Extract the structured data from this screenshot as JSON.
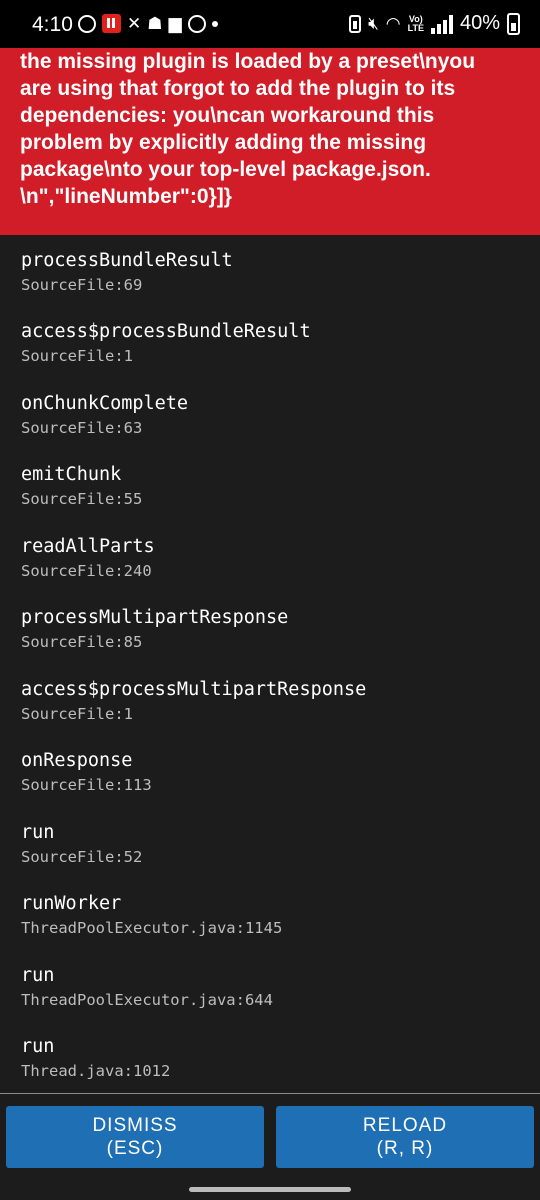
{
  "status_bar": {
    "time": "4:10",
    "battery": "40%",
    "left_icons": [
      "whatsapp-icon",
      "vi-app-icon",
      "missed-call-icon",
      "snapchat-icon",
      "teams-icon",
      "app-icon"
    ],
    "right_icons": [
      "battery-saver-icon",
      "mute-icon",
      "wifi-icon",
      "volte-icon",
      "signal-icon",
      "battery-icon"
    ],
    "volte_label": "Vo) R\nLTE"
  },
  "error": {
    "message": "y ... g y ... p\nthe missing plugin is loaded by a preset\\nyou\nare using that forgot to add the plugin to its\ndependencies: you\\ncan workaround this\nproblem by explicitly adding the missing\npackage\\nto your top-level package.json.\n\\n\",\"lineNumber\":0}]}",
    "background": "#d01d28"
  },
  "stack_frames": [
    {
      "method": "processBundleResult",
      "source": "SourceFile:69"
    },
    {
      "method": "access$processBundleResult",
      "source": "SourceFile:1"
    },
    {
      "method": "onChunkComplete",
      "source": "SourceFile:63"
    },
    {
      "method": "emitChunk",
      "source": "SourceFile:55"
    },
    {
      "method": "readAllParts",
      "source": "SourceFile:240"
    },
    {
      "method": "processMultipartResponse",
      "source": "SourceFile:85"
    },
    {
      "method": "access$processMultipartResponse",
      "source": "SourceFile:1"
    },
    {
      "method": "onResponse",
      "source": "SourceFile:113"
    },
    {
      "method": "run",
      "source": "SourceFile:52"
    },
    {
      "method": "runWorker",
      "source": "ThreadPoolExecutor.java:1145"
    },
    {
      "method": "run",
      "source": "ThreadPoolExecutor.java:644"
    },
    {
      "method": "run",
      "source": "Thread.java:1012"
    }
  ],
  "buttons": {
    "dismiss": {
      "label": "DISMISS",
      "shortcut": "(ESC)"
    },
    "reload": {
      "label": "RELOAD",
      "shortcut": "(R, R)"
    },
    "color": "#1f6fb5"
  }
}
